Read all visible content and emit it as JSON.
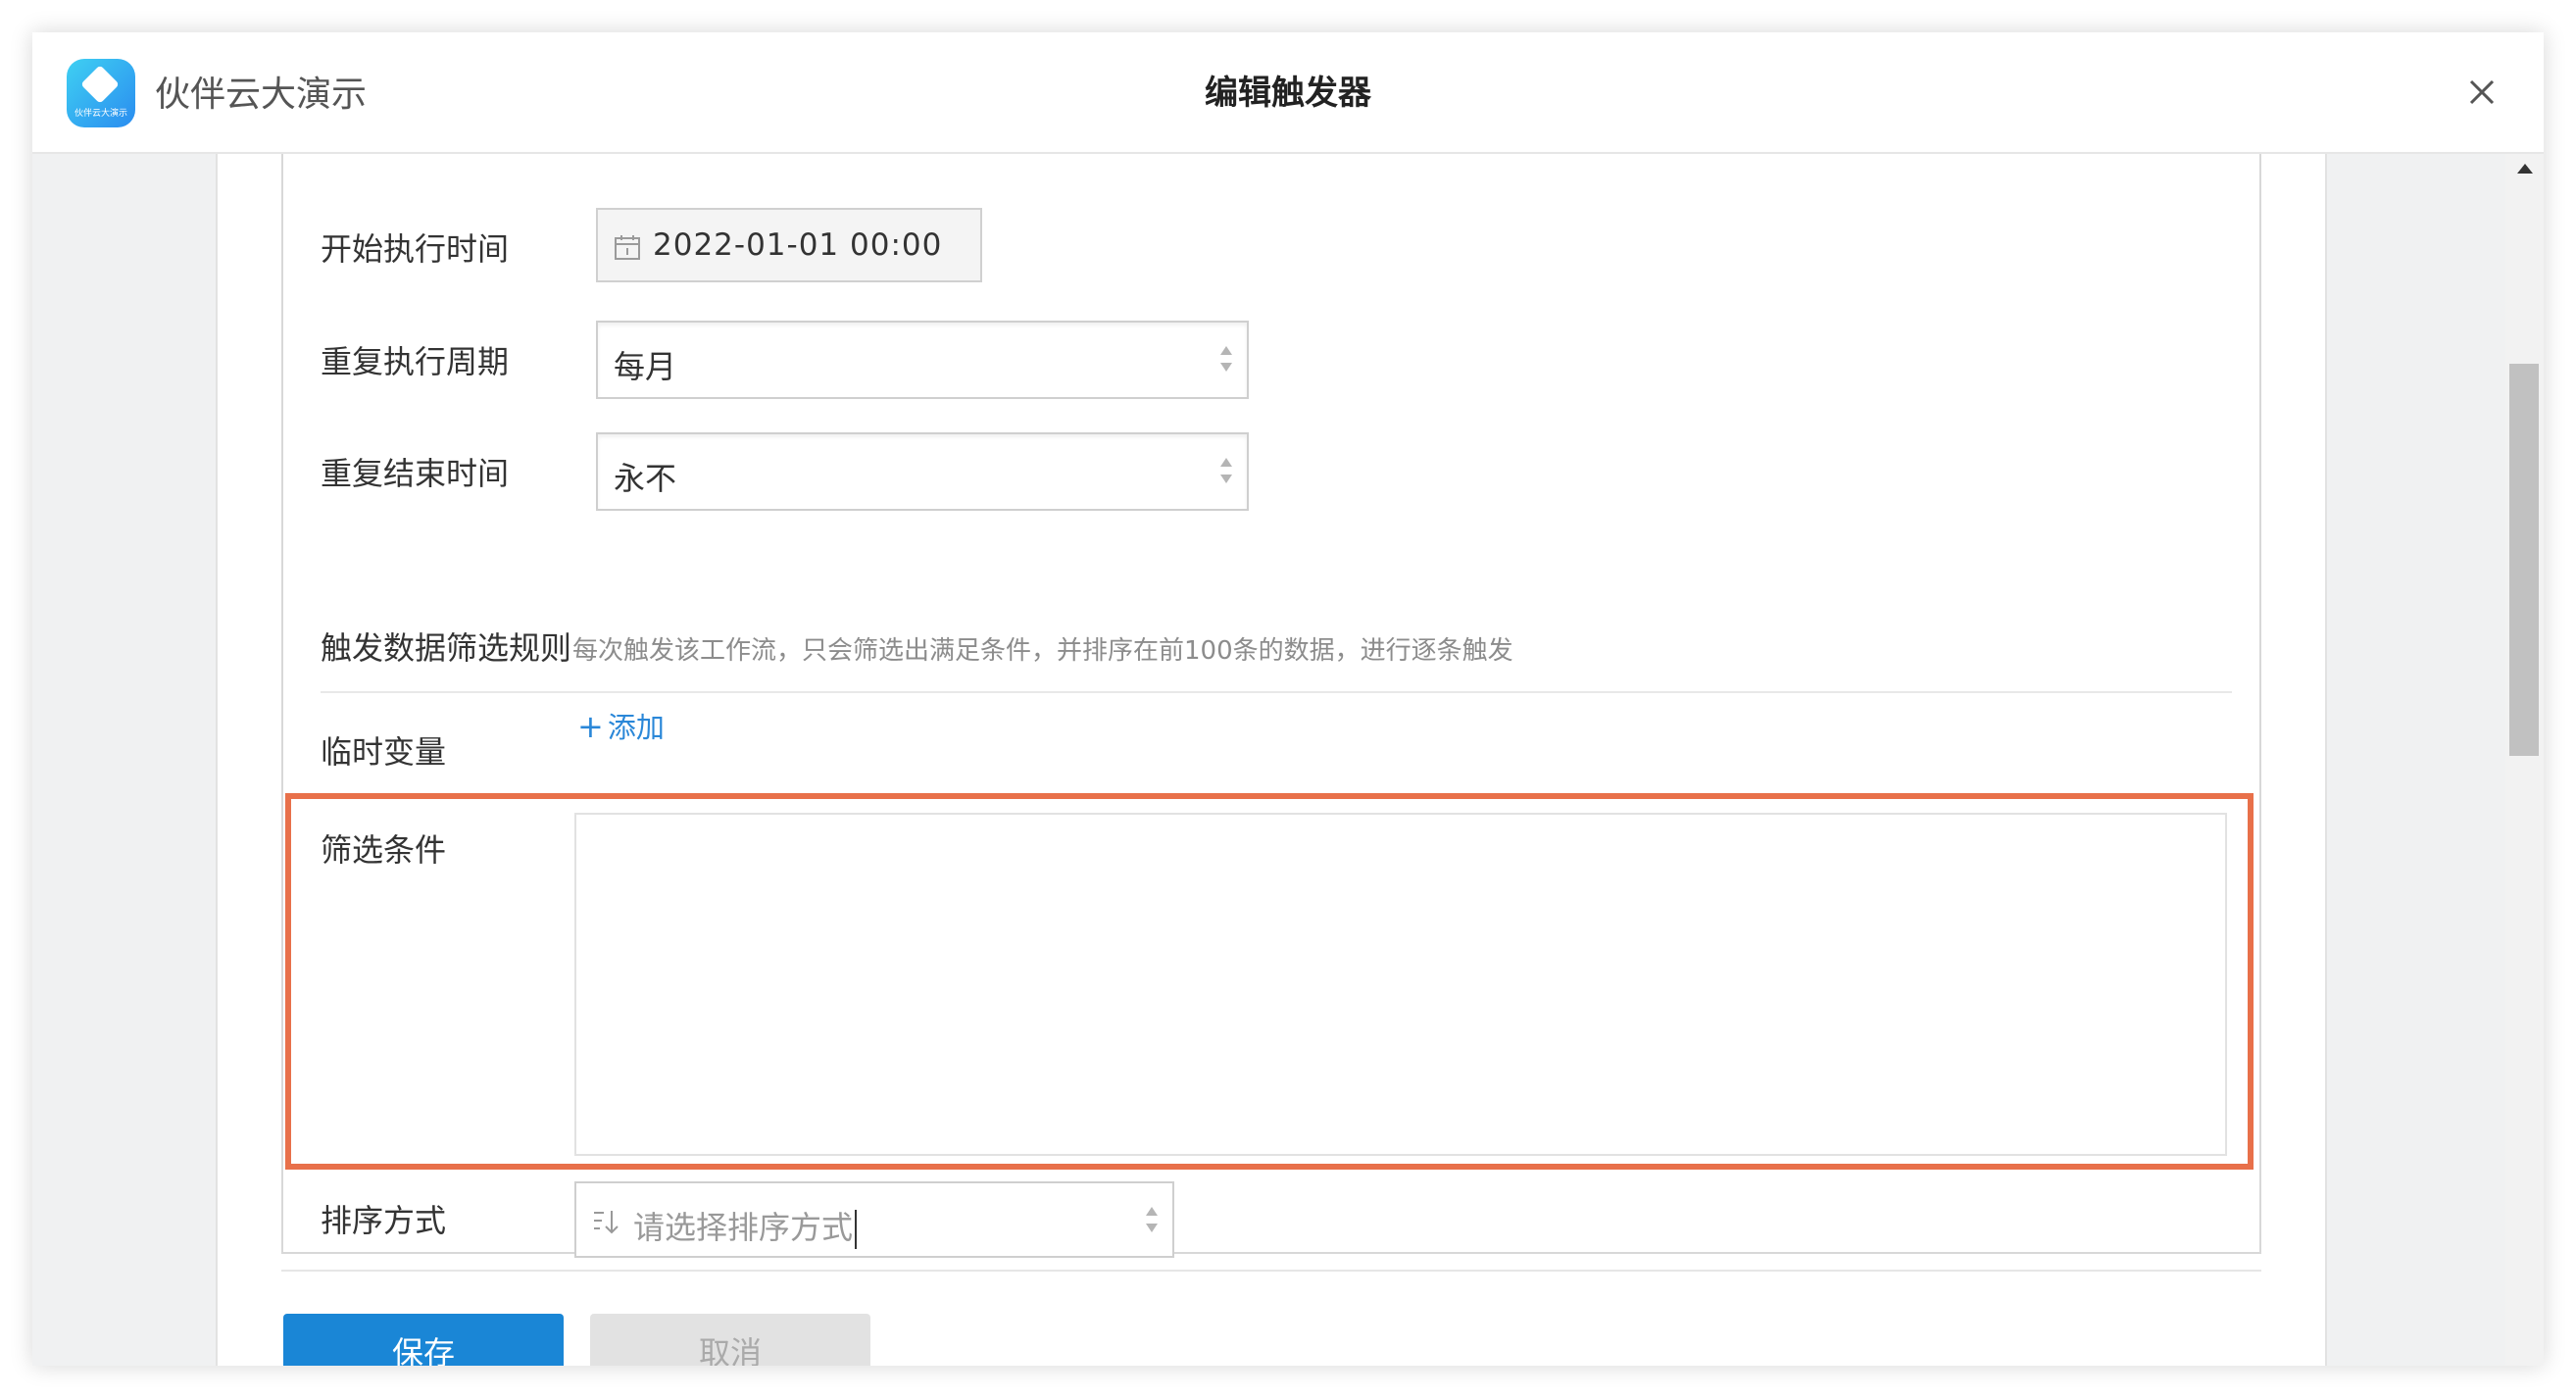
{
  "app": {
    "name": "伙伴云大演示",
    "logo_subtext": "伙伴云大演示"
  },
  "dialog": {
    "title": "编辑触发器",
    "close_icon": "close-icon"
  },
  "form": {
    "start_time": {
      "label": "开始执行时间",
      "value": "2022-01-01 00:00",
      "icon": "calendar-icon"
    },
    "repeat_period": {
      "label": "重复执行周期",
      "value": "每月"
    },
    "repeat_end": {
      "label": "重复结束时间",
      "value": "永不"
    },
    "filter_rules": {
      "title": "触发数据筛选规则",
      "description": "每次触发该工作流，只会筛选出满足条件，并排序在前100条的数据，进行逐条触发"
    },
    "temp_vars": {
      "label": "临时变量",
      "add_label": "添加"
    },
    "filter_conditions": {
      "label": "筛选条件",
      "value": ""
    },
    "sort": {
      "label": "排序方式",
      "placeholder": "请选择排序方式",
      "icon": "sort-icon"
    }
  },
  "buttons": {
    "save": "保存",
    "cancel": "取消"
  },
  "colors": {
    "primary": "#1a86d6",
    "highlight": "#e8704a",
    "link": "#2a87d8"
  }
}
